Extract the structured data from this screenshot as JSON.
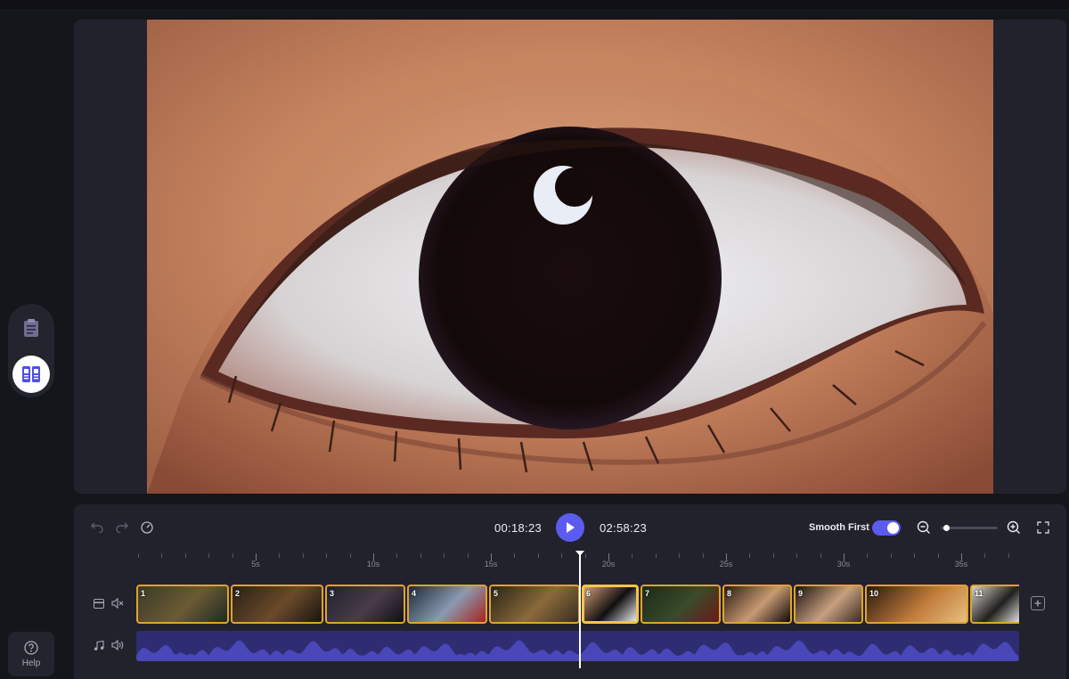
{
  "toolbar": {
    "current_time": "00:18:23",
    "total_time": "02:58:23",
    "smooth_label": "Smooth First",
    "smooth_enabled": true,
    "zoom_level": 0.05
  },
  "sidebar": {
    "items": [
      {
        "icon": "clipboard-icon",
        "active": false
      },
      {
        "icon": "storyboard-icon",
        "active": true
      }
    ],
    "help_label": "Help"
  },
  "ruler": {
    "labels": [
      "5s",
      "10s",
      "15s",
      "20s",
      "25s",
      "30s",
      "35s"
    ]
  },
  "timeline": {
    "playhead_seconds": 18.8,
    "clips": [
      {
        "label": "1",
        "selected": false
      },
      {
        "label": "2",
        "selected": false
      },
      {
        "label": "3",
        "selected": false
      },
      {
        "label": "4",
        "selected": false
      },
      {
        "label": "5",
        "selected": false
      },
      {
        "label": "6",
        "selected": true
      },
      {
        "label": "7",
        "selected": false
      },
      {
        "label": "8",
        "selected": false
      },
      {
        "label": "9",
        "selected": false
      },
      {
        "label": "10",
        "selected": false
      },
      {
        "label": "11",
        "selected": false
      }
    ]
  },
  "colors": {
    "accent": "#5b5bf0",
    "clip_border": "#e0a32c",
    "audio_track": "#2e2d72",
    "audio_wave": "#4a47b8"
  }
}
